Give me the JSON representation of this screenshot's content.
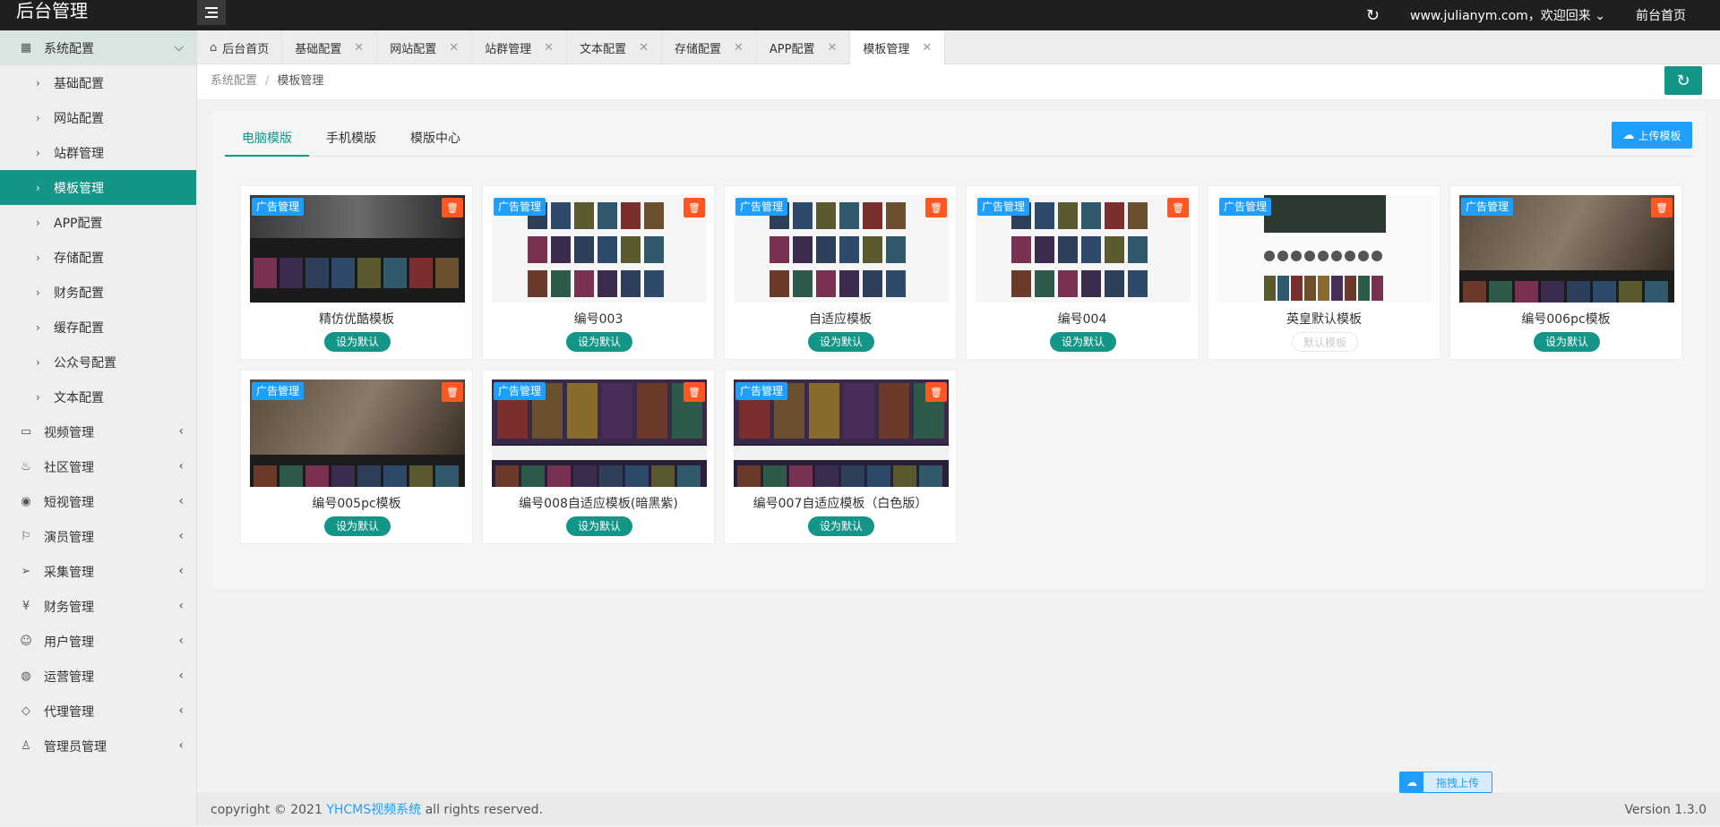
{
  "app": {
    "title": "后台管理",
    "user_greeting": "www.julianym.com，欢迎回来",
    "frontend_link": "前台首页"
  },
  "sidebar": {
    "config_group": {
      "label": "系统配置"
    },
    "config_items": [
      {
        "label": "基础配置"
      },
      {
        "label": "网站配置"
      },
      {
        "label": "站群管理"
      },
      {
        "label": "模板管理",
        "active": true
      },
      {
        "label": "APP配置"
      },
      {
        "label": "存储配置"
      },
      {
        "label": "财务配置"
      },
      {
        "label": "缓存配置"
      },
      {
        "label": "公众号配置"
      },
      {
        "label": "文本配置"
      }
    ],
    "groups": [
      {
        "label": "视频管理",
        "icon": "video-icon"
      },
      {
        "label": "社区管理",
        "icon": "flame-icon"
      },
      {
        "label": "短视管理",
        "icon": "play-circle-icon"
      },
      {
        "label": "演员管理",
        "icon": "flag-icon"
      },
      {
        "label": "采集管理",
        "icon": "send-icon"
      },
      {
        "label": "财务管理",
        "icon": "yen-icon"
      },
      {
        "label": "用户管理",
        "icon": "users-icon"
      },
      {
        "label": "运营管理",
        "icon": "globe-icon"
      },
      {
        "label": "代理管理",
        "icon": "diamond-icon"
      },
      {
        "label": "管理员管理",
        "icon": "user-icon"
      }
    ]
  },
  "tabs": [
    {
      "label": "后台首页",
      "icon": "home-icon",
      "closable": false
    },
    {
      "label": "基础配置",
      "closable": true
    },
    {
      "label": "网站配置",
      "closable": true
    },
    {
      "label": "站群管理",
      "closable": true
    },
    {
      "label": "文本配置",
      "closable": true
    },
    {
      "label": "存储配置",
      "closable": true
    },
    {
      "label": "APP配置",
      "closable": true
    },
    {
      "label": "模板管理",
      "closable": true,
      "active": true
    }
  ],
  "breadcrumb": {
    "parent": "系统配置",
    "separator": "/",
    "current": "模板管理"
  },
  "content_tabs": [
    {
      "label": "电脑模版",
      "active": true
    },
    {
      "label": "手机模版"
    },
    {
      "label": "模版中心"
    }
  ],
  "upload_button": "上传模板",
  "ad_tag": "广告管理",
  "set_default_label": "设为默认",
  "templates": [
    {
      "name": "精仿优酷模板",
      "button": "设为默认",
      "is_default": false,
      "thumb_style": "dark-grid"
    },
    {
      "name": "编号003",
      "button": "设为默认",
      "is_default": false,
      "thumb_style": "light-posters"
    },
    {
      "name": "自适应模板",
      "button": "设为默认",
      "is_default": false,
      "thumb_style": "light-posters"
    },
    {
      "name": "编号004",
      "button": "设为默认",
      "is_default": false,
      "thumb_style": "light-posters"
    },
    {
      "name": "英皇默认模板",
      "button": "默认模板",
      "is_default": true,
      "thumb_style": "light-avatars"
    },
    {
      "name": "编号006pc模板",
      "button": "设为默认",
      "is_default": false,
      "thumb_style": "dark-banner"
    },
    {
      "name": "编号005pc模板",
      "button": "设为默认",
      "is_default": false,
      "thumb_style": "dark-banner"
    },
    {
      "name": "编号008自适应模板(暗黑紫)",
      "button": "设为默认",
      "is_default": false,
      "thumb_style": "purple"
    },
    {
      "name": "编号007自适应模板（白色版）",
      "button": "设为默认",
      "is_default": false,
      "thumb_style": "purple"
    }
  ],
  "footer": {
    "copyright_prefix": "copyright © 2021",
    "brand": "YHCMS视频系统",
    "copyright_suffix": "all rights reserved.",
    "version": "Version 1.3.0"
  },
  "drag_upload": "拖拽上传",
  "colors": {
    "primary": "#139688",
    "accent": "#1e9fff",
    "danger": "#ff5722",
    "topbar": "#1f1f1f"
  }
}
